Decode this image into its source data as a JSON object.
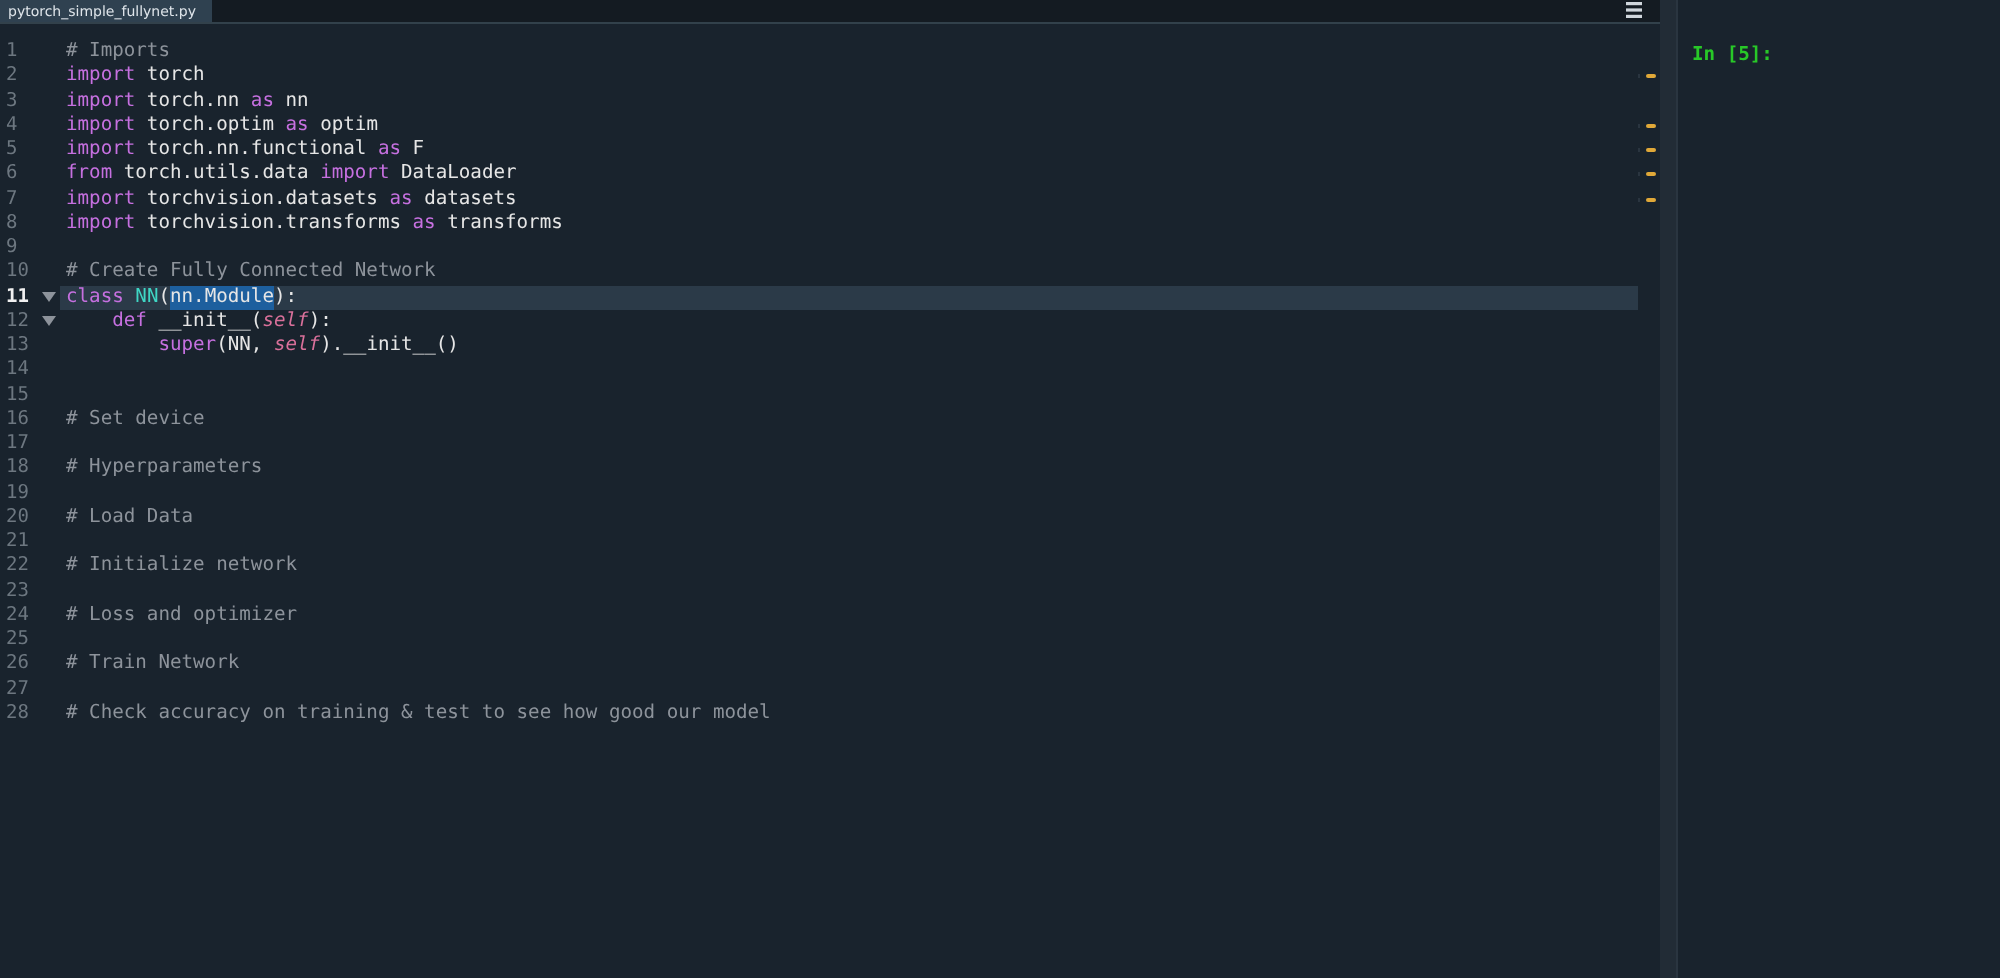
{
  "editor": {
    "tabs": [
      {
        "label": "pytorch_simple_fullynet.py",
        "selected": true
      }
    ],
    "lines": [
      {
        "number": "1",
        "warning": false,
        "foldable": false,
        "current": false,
        "tokens": [
          {
            "kind": "comment",
            "text": "# Imports"
          }
        ]
      },
      {
        "number": "2",
        "warning": true,
        "foldable": false,
        "current": false,
        "tokens": [
          {
            "kind": "keyword",
            "text": "import"
          },
          {
            "kind": "plain",
            "text": " torch"
          }
        ]
      },
      {
        "number": "3",
        "warning": false,
        "foldable": false,
        "current": false,
        "tokens": [
          {
            "kind": "keyword",
            "text": "import"
          },
          {
            "kind": "plain",
            "text": " torch.nn "
          },
          {
            "kind": "keyword",
            "text": "as"
          },
          {
            "kind": "plain",
            "text": " nn"
          }
        ]
      },
      {
        "number": "4",
        "warning": true,
        "foldable": false,
        "current": false,
        "tokens": [
          {
            "kind": "keyword",
            "text": "import"
          },
          {
            "kind": "plain",
            "text": " torch.optim "
          },
          {
            "kind": "keyword",
            "text": "as"
          },
          {
            "kind": "plain",
            "text": " optim"
          }
        ]
      },
      {
        "number": "5",
        "warning": true,
        "foldable": false,
        "current": false,
        "tokens": [
          {
            "kind": "keyword",
            "text": "import"
          },
          {
            "kind": "plain",
            "text": " torch.nn.functional "
          },
          {
            "kind": "keyword",
            "text": "as"
          },
          {
            "kind": "plain",
            "text": " F"
          }
        ]
      },
      {
        "number": "6",
        "warning": true,
        "foldable": false,
        "current": false,
        "tokens": [
          {
            "kind": "keyword",
            "text": "from"
          },
          {
            "kind": "plain",
            "text": " torch.utils.data "
          },
          {
            "kind": "keyword",
            "text": "import"
          },
          {
            "kind": "plain",
            "text": " DataLoader"
          }
        ]
      },
      {
        "number": "7",
        "warning": true,
        "foldable": false,
        "current": false,
        "tokens": [
          {
            "kind": "keyword",
            "text": "import"
          },
          {
            "kind": "plain",
            "text": " torchvision.datasets "
          },
          {
            "kind": "keyword",
            "text": "as"
          },
          {
            "kind": "plain",
            "text": " datasets"
          }
        ]
      },
      {
        "number": "8",
        "warning": false,
        "foldable": false,
        "current": false,
        "tokens": [
          {
            "kind": "keyword",
            "text": "import"
          },
          {
            "kind": "plain",
            "text": " torchvision.transforms "
          },
          {
            "kind": "keyword",
            "text": "as"
          },
          {
            "kind": "plain",
            "text": " transforms"
          }
        ]
      },
      {
        "number": "9",
        "warning": false,
        "foldable": false,
        "current": false
      },
      {
        "number": "10",
        "warning": false,
        "foldable": false,
        "current": false,
        "tokens": [
          {
            "kind": "comment",
            "text": "# Create Fully Connected Network"
          }
        ]
      },
      {
        "number": "11",
        "warning": false,
        "foldable": true,
        "current": true,
        "tokens": [
          {
            "kind": "keyword",
            "text": "class"
          },
          {
            "kind": "classname",
            "text": " NN"
          },
          {
            "kind": "plain",
            "text": "("
          },
          {
            "kind": "selected",
            "text": "nn.Module"
          },
          {
            "kind": "plain",
            "text": "):"
          }
        ]
      },
      {
        "number": "12",
        "warning": false,
        "foldable": true,
        "current": false,
        "tokens": [
          {
            "kind": "keyword",
            "text": "    def"
          },
          {
            "kind": "plain",
            "text": " __init__("
          },
          {
            "kind": "self",
            "text": "self"
          },
          {
            "kind": "plain",
            "text": "):"
          }
        ]
      },
      {
        "number": "13",
        "warning": false,
        "foldable": false,
        "current": false,
        "tokens": [
          {
            "kind": "builtin",
            "text": "        super"
          },
          {
            "kind": "plain",
            "text": "(NN, "
          },
          {
            "kind": "self",
            "text": "self"
          },
          {
            "kind": "plain",
            "text": ").__init__()"
          }
        ]
      },
      {
        "number": "14",
        "warning": false,
        "foldable": false,
        "current": false
      },
      {
        "number": "15",
        "warning": false,
        "foldable": false,
        "current": false
      },
      {
        "number": "16",
        "warning": false,
        "foldable": false,
        "current": false,
        "tokens": [
          {
            "kind": "comment",
            "text": "# Set device"
          }
        ]
      },
      {
        "number": "17",
        "warning": false,
        "foldable": false,
        "current": false
      },
      {
        "number": "18",
        "warning": false,
        "foldable": false,
        "current": false,
        "tokens": [
          {
            "kind": "comment",
            "text": "# Hyperparameters"
          }
        ]
      },
      {
        "number": "19",
        "warning": false,
        "foldable": false,
        "current": false
      },
      {
        "number": "20",
        "warning": false,
        "foldable": false,
        "current": false,
        "tokens": [
          {
            "kind": "comment",
            "text": "# Load Data"
          }
        ]
      },
      {
        "number": "21",
        "warning": false,
        "foldable": false,
        "current": false
      },
      {
        "number": "22",
        "warning": false,
        "foldable": false,
        "current": false,
        "tokens": [
          {
            "kind": "comment",
            "text": "# Initialize network"
          }
        ]
      },
      {
        "number": "23",
        "warning": false,
        "foldable": false,
        "current": false
      },
      {
        "number": "24",
        "warning": false,
        "foldable": false,
        "current": false,
        "tokens": [
          {
            "kind": "comment",
            "text": "# Loss and optimizer"
          }
        ]
      },
      {
        "number": "25",
        "warning": false,
        "foldable": false,
        "current": false
      },
      {
        "number": "26",
        "warning": false,
        "foldable": false,
        "current": false,
        "tokens": [
          {
            "kind": "comment",
            "text": "# Train Network"
          }
        ]
      },
      {
        "number": "27",
        "warning": false,
        "foldable": false,
        "current": false
      },
      {
        "number": "28",
        "warning": false,
        "foldable": false,
        "current": false,
        "tokens": [
          {
            "kind": "comment",
            "text": "# Check accuracy on training & test to see how good our model"
          }
        ]
      }
    ]
  },
  "console": {
    "prompt": "In [5]:"
  }
}
